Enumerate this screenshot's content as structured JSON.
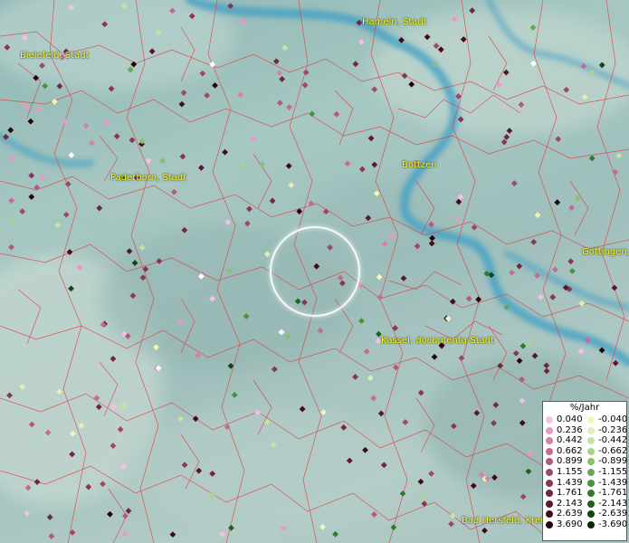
{
  "cities": [
    "Bielefeld, Stadt",
    "Hameln, Stadt",
    "Paderborn, Stadt",
    "Bottzen",
    "Göttingen, ...",
    "Kassel, documenta-Stadt",
    "Bad Hersfeld, Krei"
  ],
  "legend": {
    "title": "%/Jahr",
    "rows": [
      {
        "pos": "0.040",
        "neg": "-0.040",
        "pos_color": "#f6bfe8",
        "neg_color": "#f2f7b8"
      },
      {
        "pos": "0.236",
        "neg": "-0.236",
        "pos_color": "#e79ac8",
        "neg_color": "#dff0b0"
      },
      {
        "pos": "0.442",
        "neg": "-0.442",
        "pos_color": "#d681aa",
        "neg_color": "#c8e49d"
      },
      {
        "pos": "0.662",
        "neg": "-0.662",
        "pos_color": "#c66a93",
        "neg_color": "#a9d48a"
      },
      {
        "pos": "0.899",
        "neg": "-0.899",
        "pos_color": "#b3597d",
        "neg_color": "#87c16f"
      },
      {
        "pos": "1.155",
        "neg": "-1.155",
        "pos_color": "#9e4869",
        "neg_color": "#66a955"
      },
      {
        "pos": "1.439",
        "neg": "-1.439",
        "pos_color": "#893654",
        "neg_color": "#4a9140"
      },
      {
        "pos": "1.761",
        "neg": "-1.761",
        "pos_color": "#722640",
        "neg_color": "#327a2f"
      },
      {
        "pos": "2.143",
        "neg": "-2.143",
        "pos_color": "#5a172d",
        "neg_color": "#1f6220"
      },
      {
        "pos": "2.639",
        "neg": "-2.639",
        "pos_color": "#410b1b",
        "neg_color": "#114514"
      },
      {
        "pos": "3.690",
        "neg": "-3.690",
        "pos_color": "#25030b",
        "neg_color": "#072a08"
      }
    ]
  }
}
